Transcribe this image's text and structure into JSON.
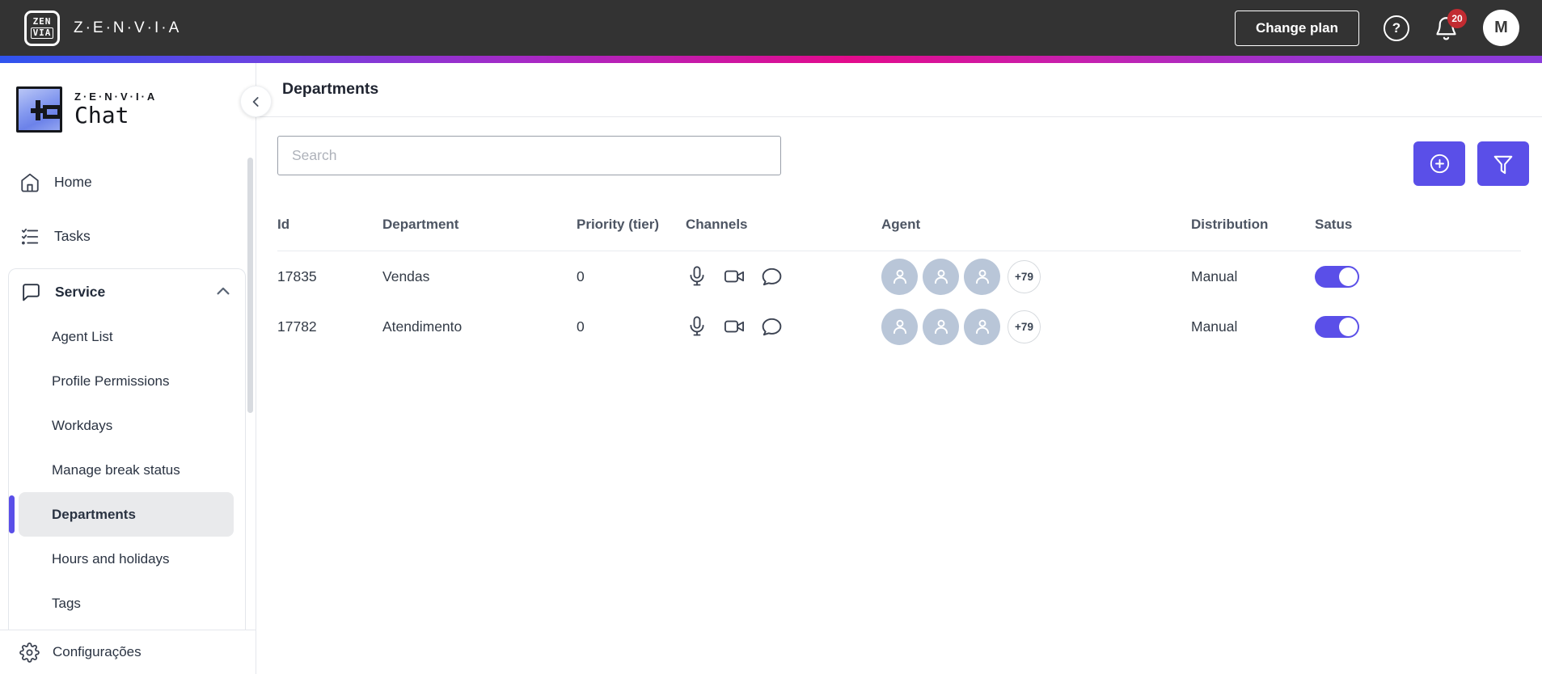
{
  "topbar": {
    "logo_mark_top": "ZEN",
    "logo_mark_bottom": "VIA",
    "brand": "Z·E·N·V·I·A",
    "change_plan_label": "Change plan",
    "help_glyph": "?",
    "notification_badge": "20",
    "avatar_initial": "M"
  },
  "sidebar": {
    "logo_brand": "Z·E·N·V·I·A",
    "logo_product": "Chat",
    "items": [
      {
        "label": "Home",
        "icon": "home-icon"
      },
      {
        "label": "Tasks",
        "icon": "tasks-icon"
      }
    ],
    "service": {
      "label": "Service",
      "icon": "chat-bubble-icon",
      "expanded": true,
      "items": [
        "Agent List",
        "Profile Permissions",
        "Workdays",
        "Manage break status",
        "Departments",
        "Hours and holidays",
        "Tags"
      ],
      "selected_item": "Departments"
    },
    "settings": {
      "label": "Configurações",
      "icon": "gear-icon"
    }
  },
  "main": {
    "title": "Departments",
    "search": {
      "placeholder": "Search"
    },
    "actions": [
      {
        "name": "add",
        "icon": "plus-circle-icon"
      },
      {
        "name": "filter",
        "icon": "funnel-icon"
      }
    ],
    "table": {
      "headers": [
        "Id",
        "Department",
        "Priority (tier)",
        "Channels",
        "Agent",
        "Distribution",
        "Satus"
      ],
      "rows": [
        {
          "id": "17835",
          "department": "Vendas",
          "priority": "0",
          "channels": [
            "microphone",
            "video-camera",
            "chat-bubble"
          ],
          "agents_overflow": "+79",
          "distribution": "Manual",
          "status_enabled": true
        },
        {
          "id": "17782",
          "department": "Atendimento",
          "priority": "0",
          "channels": [
            "microphone",
            "video-camera",
            "chat-bubble"
          ],
          "agents_overflow": "+79",
          "distribution": "Manual",
          "status_enabled": true
        }
      ]
    }
  },
  "colors": {
    "topbar_bg": "#333333",
    "accent_purple": "#5a4fe8",
    "badge_red": "#c22b31",
    "avatar_gray_blue": "#b9c6d8",
    "gradient_left": "#2f54ee",
    "gradient_mid": "#e30b8c",
    "gradient_right": "#8a3cdb"
  }
}
